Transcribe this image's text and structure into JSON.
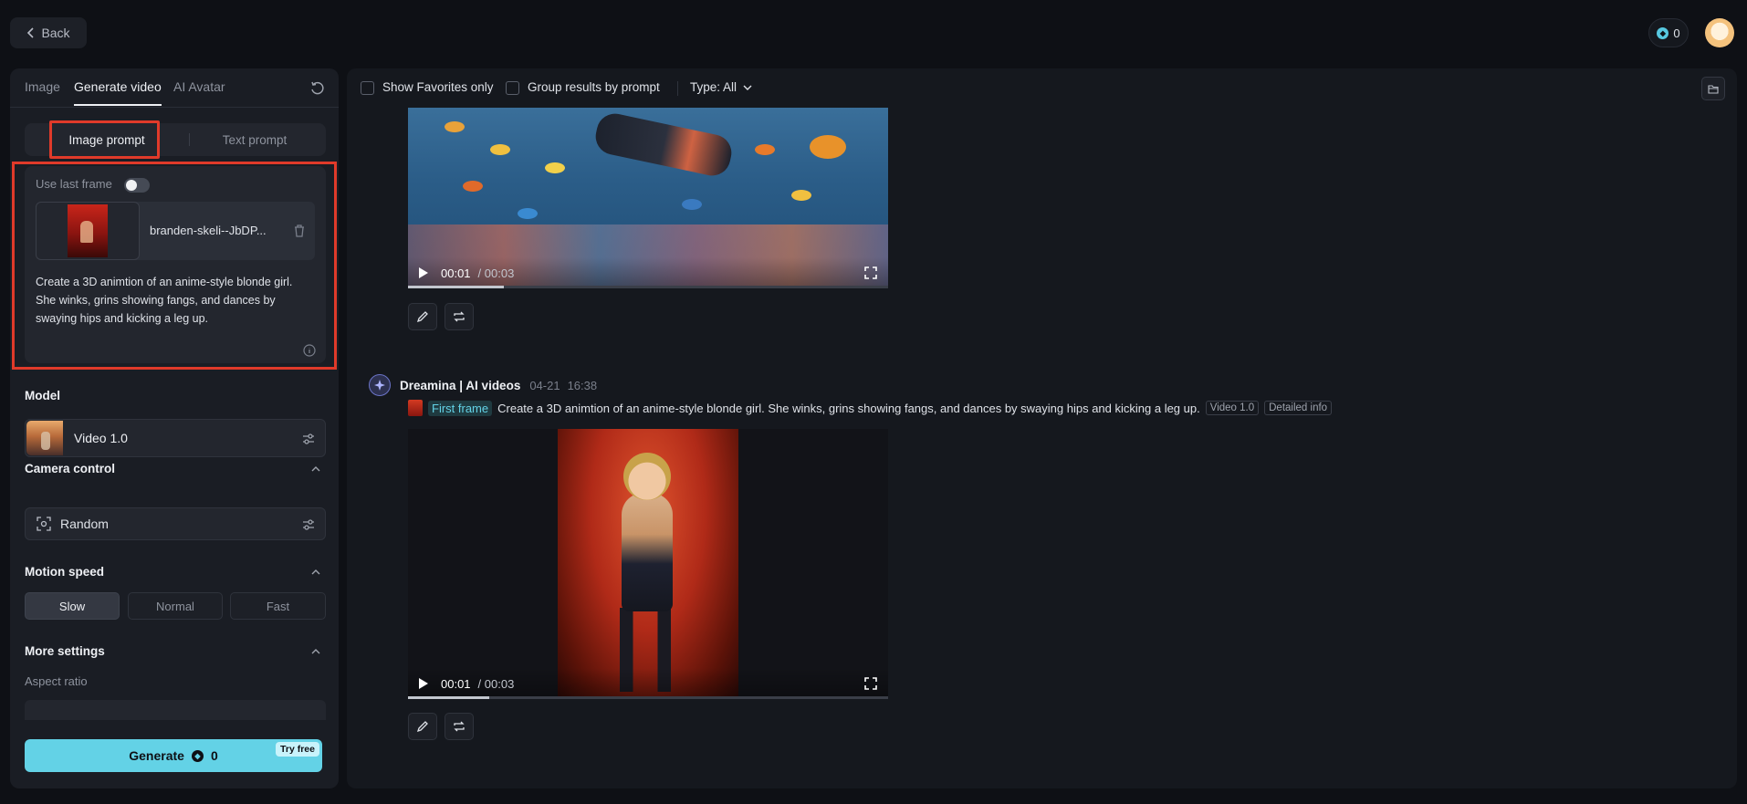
{
  "topbar": {
    "back_label": "Back",
    "credits": "0"
  },
  "left": {
    "tabs": [
      "Image",
      "Generate video",
      "AI Avatar"
    ],
    "prompt_modes": [
      "Image prompt",
      "Text prompt"
    ],
    "use_last_frame_label": "Use last frame",
    "file_name": "branden-skeli--JbDP...",
    "prompt_text": "Create a 3D animtion of an anime-style blonde girl. She winks, grins showing fangs, and dances by swaying hips and kicking a leg up.",
    "model_title": "Model",
    "model_value": "Video 1.0",
    "camera_title": "Camera control",
    "camera_value": "Random",
    "speed_title": "Motion speed",
    "speeds": [
      "Slow",
      "Normal",
      "Fast"
    ],
    "speed_selected": "Slow",
    "more_title": "More settings",
    "aspect_label": "Aspect ratio",
    "generate_label": "Generate",
    "generate_cost": "0",
    "try_badge": "Try free"
  },
  "filters": {
    "favorites_label": "Show Favorites only",
    "group_label": "Group results by prompt",
    "type_label": "Type: All"
  },
  "results": [
    {
      "time_current": "00:01",
      "time_total": "00:03",
      "progress": 0.2
    },
    {
      "brand": "Dreamina | AI videos",
      "date": "04-21",
      "time": "16:38",
      "first_frame_tag": "First frame",
      "prompt": "Create a 3D animtion of an anime-style blonde girl. She winks, grins showing fangs, and dances by swaying hips and kicking a leg up.",
      "chips": [
        "Video 1.0",
        "Detailed info"
      ],
      "time_current": "00:01",
      "time_total": "00:03",
      "progress": 0.17
    }
  ],
  "colors": {
    "accent": "#63d2e6",
    "highlight": "#e03a2a"
  }
}
